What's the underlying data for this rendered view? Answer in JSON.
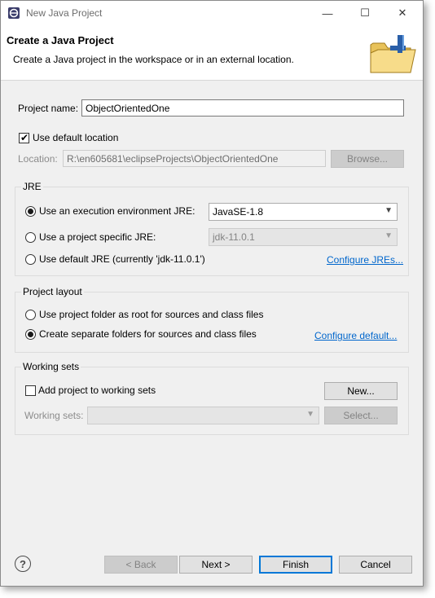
{
  "window": {
    "title": "New Java Project",
    "controls": {
      "minimize": "—",
      "maximize": "☐",
      "close": "✕"
    }
  },
  "banner": {
    "title": "Create a Java Project",
    "description": "Create a Java project in the workspace or in an external location.",
    "icon": "new-folder-wizard-icon"
  },
  "project": {
    "name_label": "Project name:",
    "name_value": "ObjectOrientedOne"
  },
  "location": {
    "use_default_label": "Use default location",
    "use_default_checked": true,
    "location_label": "Location:",
    "location_value": "R:\\en605681\\eclipseProjects\\ObjectOrientedOne",
    "browse_label": "Browse..."
  },
  "jre": {
    "group_label": "JRE",
    "options": [
      {
        "label": "Use an execution environment JRE:",
        "selected": true
      },
      {
        "label": "Use a project specific JRE:",
        "selected": false
      },
      {
        "label": "Use default JRE (currently 'jdk-11.0.1')",
        "selected": false
      }
    ],
    "env_combo_value": "JavaSE-1.8",
    "specific_combo_value": "jdk-11.0.1",
    "configure_link": "Configure JREs..."
  },
  "layout": {
    "group_label": "Project layout",
    "options": [
      {
        "label": "Use project folder as root for sources and class files",
        "selected": false
      },
      {
        "label": "Create separate folders for sources and class files",
        "selected": true
      }
    ],
    "configure_link": "Configure default..."
  },
  "working_sets": {
    "group_label": "Working sets",
    "add_label": "Add project to working sets",
    "add_checked": false,
    "new_button": "New...",
    "sets_label": "Working sets:",
    "sets_value": "",
    "select_button": "Select..."
  },
  "footer": {
    "help": "?",
    "back": "< Back",
    "next": "Next >",
    "finish": "Finish",
    "cancel": "Cancel"
  },
  "colors": {
    "accent": "#0078d7",
    "link": "#0066cc",
    "dialog_bg": "#f0f0f0"
  }
}
